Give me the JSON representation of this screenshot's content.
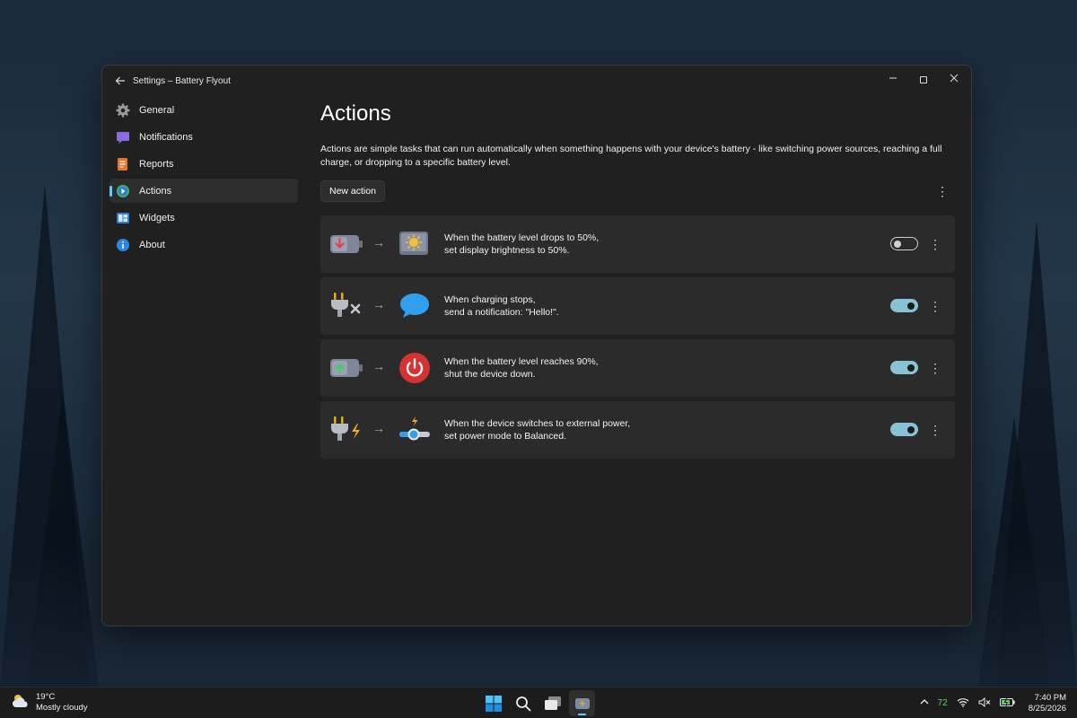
{
  "window": {
    "title": "Settings – Battery Flyout"
  },
  "sidebar": {
    "items": [
      {
        "label": "General",
        "icon": "gear-icon"
      },
      {
        "label": "Notifications",
        "icon": "chat-bubble-icon"
      },
      {
        "label": "Reports",
        "icon": "report-icon"
      },
      {
        "label": "Actions",
        "icon": "play-icon",
        "active": true
      },
      {
        "label": "Widgets",
        "icon": "widgets-icon"
      },
      {
        "label": "About",
        "icon": "info-icon"
      }
    ]
  },
  "main": {
    "title": "Actions",
    "description": "Actions are simple tasks that can run automatically when something happens with your device's battery - like switching power sources, reaching a full charge, or dropping to a specific battery level.",
    "new_action_label": "New action",
    "actions": [
      {
        "line1": "When the battery level drops to 50%,",
        "line2": "set display brightness to 50%.",
        "enabled": false,
        "trigger_icon": "battery-down-icon",
        "action_icon": "brightness-icon"
      },
      {
        "line1": "When charging stops,",
        "line2": "send a notification: \"Hello!\".",
        "enabled": true,
        "trigger_icon": "unplug-icon",
        "action_icon": "notification-bubble-icon"
      },
      {
        "line1": "When the battery level reaches 90%,",
        "line2": "shut the device down.",
        "enabled": true,
        "trigger_icon": "battery-up-icon",
        "action_icon": "power-icon"
      },
      {
        "line1": "When the device switches to external power,",
        "line2": "set power mode to Balanced.",
        "enabled": true,
        "trigger_icon": "plug-power-icon",
        "action_icon": "power-mode-slider-icon"
      }
    ]
  },
  "taskbar": {
    "weather_temp": "19°C",
    "weather_desc": "Mostly cloudy",
    "battery_percent": "72",
    "time": "7:40 PM",
    "date": "8/25/2026"
  },
  "colors": {
    "accent": "#60cdff",
    "toggle_on": "#87c3d4",
    "window_bg": "#202020",
    "card_bg": "#2b2b2b"
  }
}
